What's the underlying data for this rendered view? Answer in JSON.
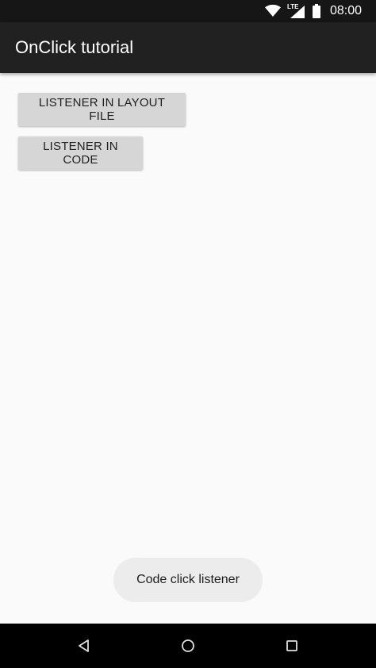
{
  "status_bar": {
    "time": "08:00",
    "network_label": "LTE",
    "icons": [
      "wifi-icon",
      "lte-signal-icon",
      "battery-icon"
    ],
    "colors": {
      "background": "#161616",
      "foreground": "#ffffff"
    }
  },
  "app_bar": {
    "title": "OnClick tutorial",
    "color": "#212121"
  },
  "buttons": {
    "layout_file_label": "LISTENER IN LAYOUT FILE",
    "code_label": "LISTENER IN CODE",
    "color": "#d6d6d6"
  },
  "toast": {
    "message": "Code click listener"
  },
  "nav_bar": {
    "icons": [
      "back-icon",
      "home-icon",
      "recents-icon"
    ]
  }
}
